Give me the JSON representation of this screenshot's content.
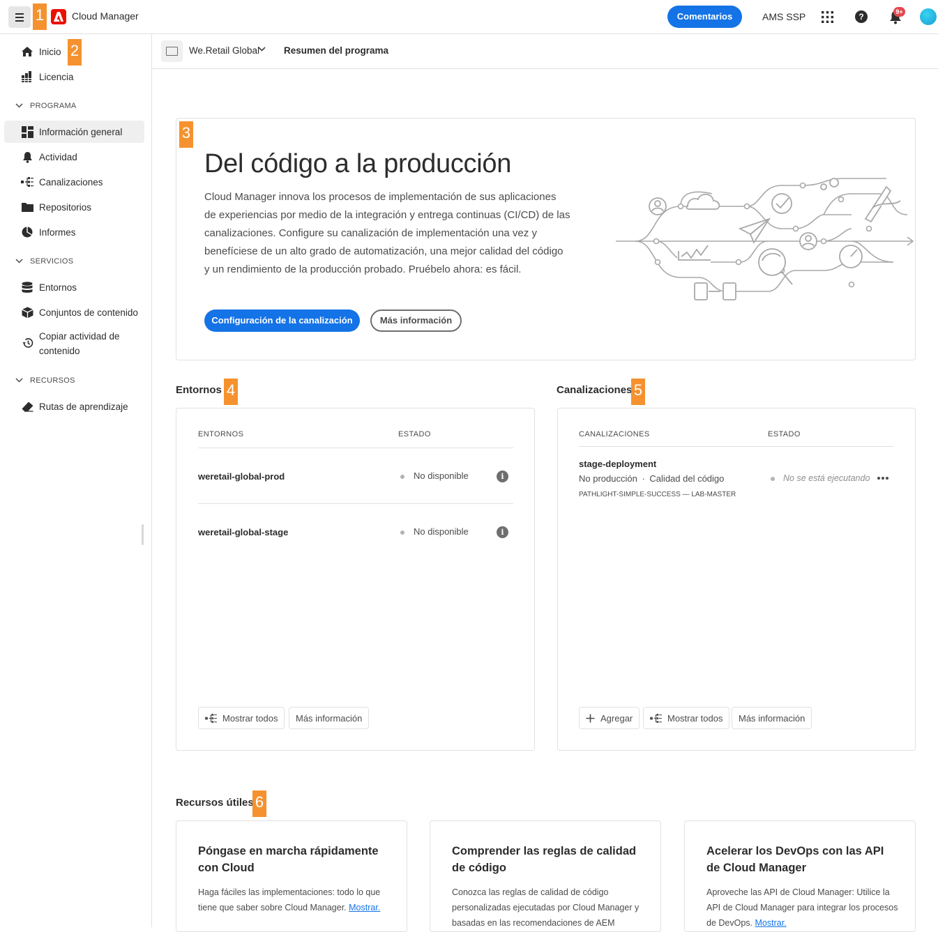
{
  "header": {
    "app_title": "Cloud Manager",
    "feedback_label": "Comentarios",
    "org_label": "AMS SSP",
    "notifications_badge": "9+",
    "icons": [
      "menu-icon",
      "adobe-logo",
      "apps-grid-icon",
      "help-icon",
      "bell-icon",
      "avatar"
    ]
  },
  "callouts": [
    "1",
    "2",
    "3",
    "4",
    "5",
    "6"
  ],
  "sidebar": {
    "top_items": [
      {
        "label": "Inicio",
        "icon": "home-icon"
      },
      {
        "label": "Licencia",
        "icon": "license-icon"
      }
    ],
    "sections": [
      {
        "title": "PROGRAMA",
        "items": [
          {
            "label": "Información general",
            "icon": "dashboard-icon",
            "active": true
          },
          {
            "label": "Actividad",
            "icon": "bell-icon"
          },
          {
            "label": "Canalizaciones",
            "icon": "pipeline-icon"
          },
          {
            "label": "Repositorios",
            "icon": "folder-icon"
          },
          {
            "label": "Informes",
            "icon": "pie-chart-icon"
          }
        ]
      },
      {
        "title": "SERVICIOS",
        "items": [
          {
            "label": "Entornos",
            "icon": "database-icon"
          },
          {
            "label": "Conjuntos de contenido",
            "icon": "box-icon"
          },
          {
            "label": "Copiar actividad de contenido",
            "icon": "history-icon"
          }
        ]
      },
      {
        "title": "RECURSOS",
        "items": [
          {
            "label": "Rutas de aprendizaje",
            "icon": "eraser-icon"
          }
        ]
      }
    ]
  },
  "breadcrumb": {
    "program_name": "We.Retail Global",
    "page_title": "Resumen del programa"
  },
  "hero": {
    "title": "Del código a la producción",
    "text": "Cloud Manager innova los procesos de implementación de sus aplicaciones de experiencias por medio de la integración y entrega continuas (CI/CD) de las canalizaciones. Configure su canalización de implementación una vez y benefíciese de un alto grado de automatización, una mejor calidad del código y un rendimiento de la producción probado. Pruébelo ahora: es fácil.",
    "primary_button": "Configuración de la canalización",
    "secondary_button": "Más información"
  },
  "environments": {
    "heading": "Entornos",
    "col_name": "ENTORNOS",
    "col_status": "ESTADO",
    "rows": [
      {
        "name": "weretail-global-prod",
        "status": "No disponible"
      },
      {
        "name": "weretail-global-stage",
        "status": "No disponible"
      }
    ],
    "show_all": "Mostrar todos",
    "more_info": "Más información"
  },
  "pipelines": {
    "heading": "Canalizaciones",
    "col_name": "CANALIZACIONES",
    "col_status": "ESTADO",
    "rows": [
      {
        "name": "stage-deployment",
        "type": "No producción",
        "separator": "·",
        "subtype": "Calidad del código",
        "meta": "PATHLIGHT-SIMPLE-SUCCESS — LAB-MASTER",
        "status": "No se está ejecutando"
      }
    ],
    "add": "Agregar",
    "show_all": "Mostrar todos",
    "more_info": "Más información"
  },
  "resources": {
    "heading": "Recursos útiles",
    "cards": [
      {
        "title": "Póngase en marcha rápidamente con Cloud",
        "text": "Haga fáciles las implementaciones: todo lo que tiene que saber sobre Cloud Manager.",
        "link": "Mostrar."
      },
      {
        "title": "Comprender las reglas de calidad de código",
        "text": "Conozca las reglas de calidad de código personalizadas ejecutadas por Cloud Manager y basadas en las recomendaciones de AEM",
        "link": ""
      },
      {
        "title": "Acelerar los DevOps con las API de Cloud Manager",
        "text": "Aproveche las API de Cloud Manager: Utilice la API de Cloud Manager para integrar los procesos de DevOps.",
        "link": "Mostrar."
      }
    ]
  },
  "colors": {
    "accent": "#1473e6",
    "callout": "#f5922f",
    "badge": "#e34850",
    "brand": "#eb1000"
  }
}
